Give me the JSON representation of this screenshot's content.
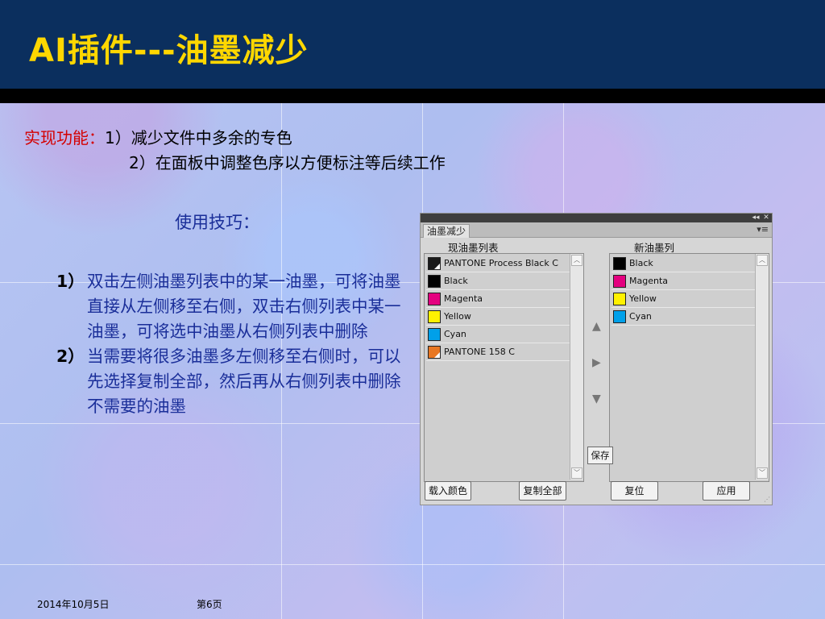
{
  "slide": {
    "title": "AI插件---油墨减少",
    "feature_label": "实现功能：",
    "feature_line1": "1）减少文件中多余的专色",
    "feature_line2": "2）在面板中调整色序以方便标注等后续工作",
    "tips_title": "使用技巧：",
    "tips": [
      {
        "num": "1）",
        "text": "双击左侧油墨列表中的某一油墨，可将油墨直接从左侧移至右侧，双击右侧列表中某一油墨，可将选中油墨从右侧列表中删除"
      },
      {
        "num": "2）",
        "text": "当需要将很多油墨多左侧移至右侧时，可以先选择复制全部，然后再从右侧列表中删除不需要的油墨"
      }
    ]
  },
  "panel": {
    "tab": "油墨减少",
    "collapse_glyph": "◂◂",
    "close_glyph": "✕",
    "menu_glyph": "▾≡",
    "left_header": "现油墨列表",
    "right_header": "新油墨列",
    "left_inks": [
      {
        "name": "PANTONE Process Black C",
        "color": "#1a1a1a",
        "spot": true
      },
      {
        "name": "Black",
        "color": "#000000",
        "spot": false
      },
      {
        "name": "Magenta",
        "color": "#e4007f",
        "spot": false
      },
      {
        "name": "Yellow",
        "color": "#fff100",
        "spot": false
      },
      {
        "name": "Cyan",
        "color": "#00a0e9",
        "spot": false
      },
      {
        "name": "PANTONE 158 C",
        "color": "#e87722",
        "spot": true
      }
    ],
    "right_inks": [
      {
        "name": "Black",
        "color": "#000000"
      },
      {
        "name": "Magenta",
        "color": "#e4007f"
      },
      {
        "name": "Yellow",
        "color": "#fff100"
      },
      {
        "name": "Cyan",
        "color": "#00a0e9"
      }
    ],
    "arrow_up": "▲",
    "arrow_right": "▶",
    "arrow_down": "▼",
    "save": "保存",
    "load_colors": "载入颜色",
    "copy_all": "复制全部",
    "reset": "复位",
    "apply": "应用"
  },
  "footer": {
    "date": "2014年10月5日",
    "page": "第6页"
  },
  "colors": {
    "header": "#0b2f5e",
    "title": "#ffd700",
    "accent_red": "#d40000",
    "body_blue": "#1a2e99"
  }
}
